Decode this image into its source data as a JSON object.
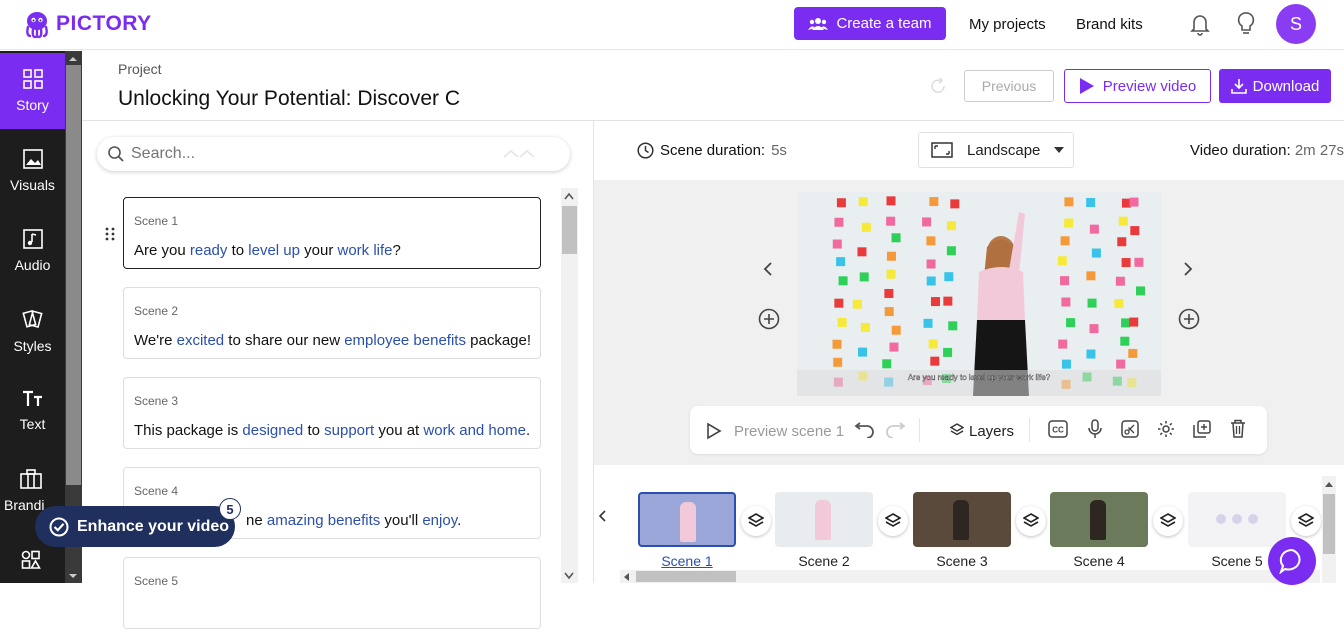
{
  "app": {
    "logo_text": "PICTORY"
  },
  "topbar": {
    "create_team_label": "Create a team",
    "my_projects_label": "My projects",
    "brand_kits_label": "Brand kits",
    "avatar_initial": "S",
    "icons": [
      "team-icon",
      "bell-icon",
      "lightbulb-icon"
    ]
  },
  "sidebar": {
    "items": [
      {
        "label": "Story",
        "icon": "story-icon",
        "active": true
      },
      {
        "label": "Visuals",
        "icon": "visuals-icon"
      },
      {
        "label": "Audio",
        "icon": "audio-icon"
      },
      {
        "label": "Styles",
        "icon": "styles-icon"
      },
      {
        "label": "Text",
        "icon": "text-icon"
      },
      {
        "label": "Brandi",
        "icon": "branding-icon"
      },
      {
        "label": "",
        "icon": "elements-icon"
      }
    ]
  },
  "project": {
    "label": "Project",
    "title": "Unlocking Your Potential: Discover C",
    "previous_label": "Previous",
    "preview_label": "Preview video",
    "download_label": "Download"
  },
  "search": {
    "placeholder": "Search..."
  },
  "scenes": [
    {
      "label": "Scene 1",
      "parts": [
        [
          "Are you ",
          false
        ],
        [
          "ready",
          true
        ],
        [
          " to ",
          false
        ],
        [
          "level up",
          true
        ],
        [
          " your ",
          false
        ],
        [
          "work life",
          true
        ],
        [
          "?",
          false
        ]
      ]
    },
    {
      "label": "Scene 2",
      "parts": [
        [
          "We're ",
          false
        ],
        [
          "excited",
          true
        ],
        [
          " to share our new ",
          false
        ],
        [
          "employee benefits",
          true
        ],
        [
          " package!",
          false
        ]
      ]
    },
    {
      "label": "Scene 3",
      "parts": [
        [
          "This package is ",
          false
        ],
        [
          "designed",
          true
        ],
        [
          " to ",
          false
        ],
        [
          "support",
          true
        ],
        [
          " you at ",
          false
        ],
        [
          "work and home",
          true
        ],
        [
          ".",
          false
        ]
      ]
    },
    {
      "label": "Scene 4",
      "parts": [
        [
          "ne ",
          false
        ],
        [
          "amazing benefits",
          true
        ],
        [
          " you'll ",
          false
        ],
        [
          "enjoy",
          true
        ],
        [
          ".",
          false
        ]
      ]
    },
    {
      "label": "Scene 5",
      "parts": []
    }
  ],
  "enhance": {
    "label": "Enhance your video",
    "count": "5"
  },
  "scene_info": {
    "duration_label": "Scene duration:",
    "duration_value": "5s",
    "orientation": "Landscape",
    "video_duration_label": "Video duration:",
    "video_duration_value": "2m 27s"
  },
  "video": {
    "caption": "Are you ready to level up your work life?"
  },
  "toolbar": {
    "preview_scene_label": "Preview scene 1",
    "layers_label": "Layers",
    "icons": [
      "play-icon",
      "undo-icon",
      "redo-icon",
      "layers-icon",
      "cc-icon",
      "mic-icon",
      "cut-icon",
      "settings-icon",
      "duplicate-icon",
      "trash-icon"
    ]
  },
  "timeline": {
    "scenes": [
      "Scene 1",
      "Scene 2",
      "Scene 3",
      "Scene 4",
      "Scene 5"
    ],
    "active_index": 0
  },
  "colors": {
    "accent": "#7a2cf0",
    "highlight": "#2b4fae",
    "sidebar_bg": "#1d1d1d",
    "enhance_bg": "#1f2f5e"
  }
}
